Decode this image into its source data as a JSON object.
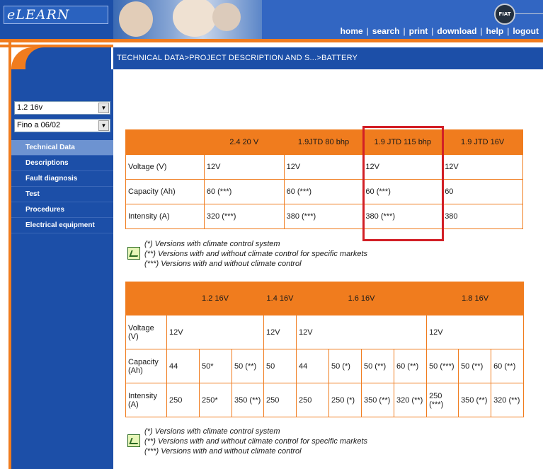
{
  "app": {
    "logo_text": "eLEARN",
    "brand_badge": "FIAT"
  },
  "topnav": [
    "home",
    "search",
    "print",
    "download",
    "help",
    "logout"
  ],
  "breadcrumb": "TECHNICAL DATA>PROJECT DESCRIPTION AND S...>BATTERY",
  "sidebar": {
    "select_model": "1.2 16v",
    "select_period": "Fino a 06/02",
    "menu": [
      "Technical Data",
      "Descriptions",
      "Fault diagnosis",
      "Test",
      "Procedures",
      "Electrical equipment"
    ],
    "active_index": 0
  },
  "table1": {
    "headers": [
      "",
      "2.4 20 V",
      "1.9JTD 80 bhp",
      "1.9 JTD 115 bhp",
      "1.9 JTD 16V"
    ],
    "rows": [
      {
        "label": "Voltage (V)",
        "cells": [
          "12V",
          "12V",
          "12V",
          "12V"
        ]
      },
      {
        "label": "Capacity (Ah)",
        "cells": [
          "60 (***)",
          "60 (***)",
          "60 (***)",
          "60"
        ]
      },
      {
        "label": "Intensity (A)",
        "cells": [
          "320 (***)",
          "380 (***)",
          "380 (***)",
          "380"
        ]
      }
    ],
    "highlighted_column": "1.9 JTD 115 bhp"
  },
  "notes": [
    "(*) Versions with climate control system",
    "(**) Versions with and without climate control for specific markets",
    "(***) Versions with and without climate control"
  ],
  "table2": {
    "headers": [
      "",
      "1.2 16V",
      "1.4 16V",
      "1.6 16V",
      "1.8 16V"
    ],
    "voltage": {
      "label": "Voltage (V)",
      "cells": [
        "12V",
        "12V",
        "12V",
        "12V"
      ]
    },
    "capacity": {
      "label": "Capacity (Ah)",
      "cells": [
        "44",
        "50*",
        "50 (**)",
        "50",
        "44",
        "50 (*)",
        "50 (**)",
        "60 (**)",
        "50 (***)",
        "50 (**)",
        "60 (**)"
      ]
    },
    "intensity": {
      "label": "Intensity (A)",
      "cells": [
        "250",
        "250*",
        "350 (**)",
        "250",
        "250",
        "250 (*)",
        "350 (**)",
        "320 (**)",
        "250 (***)",
        "350 (**)",
        "320 (**)"
      ]
    }
  },
  "colors": {
    "accent": "#f07c1e",
    "nav_blue": "#1c4fa8",
    "highlight": "#d21f26"
  }
}
